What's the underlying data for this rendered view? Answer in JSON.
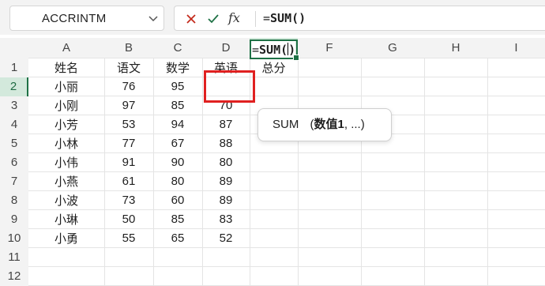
{
  "formula_bar": {
    "name_box": "ACCRINTM",
    "cancel_icon": "close-icon",
    "confirm_icon": "checkmark-icon",
    "fx_label": "fx",
    "formula_eq": "=",
    "formula_body": "SUM()"
  },
  "columns": [
    "A",
    "B",
    "C",
    "D",
    "E",
    "F",
    "G",
    "H",
    "I"
  ],
  "rows": [
    "1",
    "2",
    "3",
    "4",
    "5",
    "6",
    "7",
    "8",
    "9",
    "10",
    "11",
    "12"
  ],
  "header_row": [
    "姓名",
    "语文",
    "数学",
    "英语",
    "总分"
  ],
  "table": [
    [
      "小丽",
      "76",
      "95",
      ""
    ],
    [
      "小刚",
      "97",
      "85",
      "70"
    ],
    [
      "小芳",
      "53",
      "94",
      "87"
    ],
    [
      "小林",
      "77",
      "67",
      "88"
    ],
    [
      "小伟",
      "91",
      "90",
      "80"
    ],
    [
      "小燕",
      "61",
      "80",
      "89"
    ],
    [
      "小波",
      "73",
      "60",
      "89"
    ],
    [
      "小琳",
      "50",
      "85",
      "83"
    ],
    [
      "小勇",
      "55",
      "65",
      "52"
    ]
  ],
  "active_cell": {
    "column": "E",
    "row": "2",
    "edit_eq": "=",
    "edit_text": "SUM(",
    "edit_close": ")"
  },
  "tooltip": {
    "function": "SUM",
    "open": "(",
    "arg": "数值1",
    "rest": ", ...)"
  },
  "colors": {
    "accent": "#1e7145",
    "highlight_box": "#e02020",
    "header_bg": "#f3f3f3"
  }
}
